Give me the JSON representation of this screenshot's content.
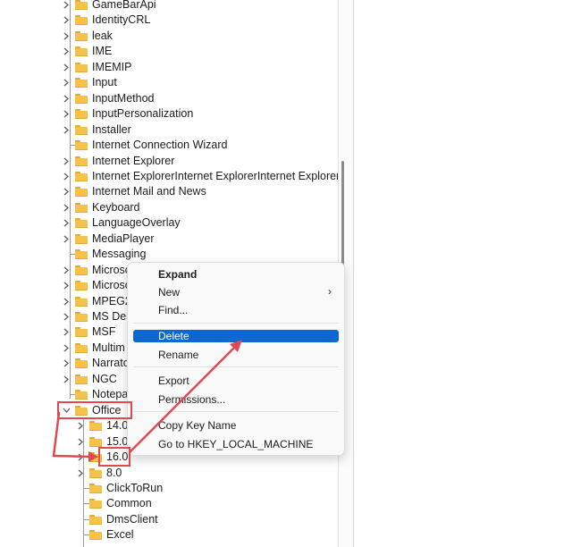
{
  "tree": {
    "items": [
      {
        "label": "GameBarApi",
        "chevron": true
      },
      {
        "label": "IdentityCRL",
        "chevron": true
      },
      {
        "label": "leak",
        "chevron": true
      },
      {
        "label": "IME",
        "chevron": true
      },
      {
        "label": "IMEMIP",
        "chevron": true
      },
      {
        "label": "Input",
        "chevron": true
      },
      {
        "label": "InputMethod",
        "chevron": true
      },
      {
        "label": "InputPersonalization",
        "chevron": true
      },
      {
        "label": "Installer",
        "chevron": true
      },
      {
        "label": "Internet Connection Wizard",
        "chevron": false
      },
      {
        "label": "Internet Explorer",
        "chevron": true
      },
      {
        "label": "Internet ExplorerInternet ExplorerInternet Explorer",
        "chevron": true
      },
      {
        "label": "Internet Mail and News",
        "chevron": true
      },
      {
        "label": "Keyboard",
        "chevron": true
      },
      {
        "label": "LanguageOverlay",
        "chevron": true
      },
      {
        "label": "MediaPlayer",
        "chevron": true
      },
      {
        "label": "Messaging",
        "chevron": false
      },
      {
        "label": "Microsc",
        "chevron": true
      },
      {
        "label": "Microsc",
        "chevron": true
      },
      {
        "label": "MPEG2",
        "chevron": true
      },
      {
        "label": "MS Des",
        "chevron": true
      },
      {
        "label": "MSF",
        "chevron": true
      },
      {
        "label": "Multim",
        "chevron": true
      },
      {
        "label": "Narrato",
        "chevron": true
      },
      {
        "label": "NGC",
        "chevron": true
      },
      {
        "label": "Notepa",
        "chevron": false
      },
      {
        "label": "Office",
        "chevron": "open"
      }
    ],
    "office_children": [
      {
        "label": "14.0",
        "chevron": true
      },
      {
        "label": "15.0",
        "chevron": true
      },
      {
        "label": "16.0",
        "chevron": true
      },
      {
        "label": "8.0",
        "chevron": true
      },
      {
        "label": "ClickToRun",
        "chevron": false
      },
      {
        "label": "Common",
        "chevron": false
      },
      {
        "label": "DmsClient",
        "chevron": false
      },
      {
        "label": "Excel",
        "chevron": false
      }
    ]
  },
  "context_menu": {
    "expand": "Expand",
    "new": "New",
    "new_arrow": "›",
    "find": "Find...",
    "delete": "Delete",
    "rename": "Rename",
    "export": "Export",
    "permissions": "Permissions...",
    "copy_key_name": "Copy Key Name",
    "goto": "Go to HKEY_LOCAL_MACHINE"
  },
  "colors": {
    "folder": "#f5c24c",
    "highlight": "#0c67d2",
    "annotation": "#e0494f"
  }
}
